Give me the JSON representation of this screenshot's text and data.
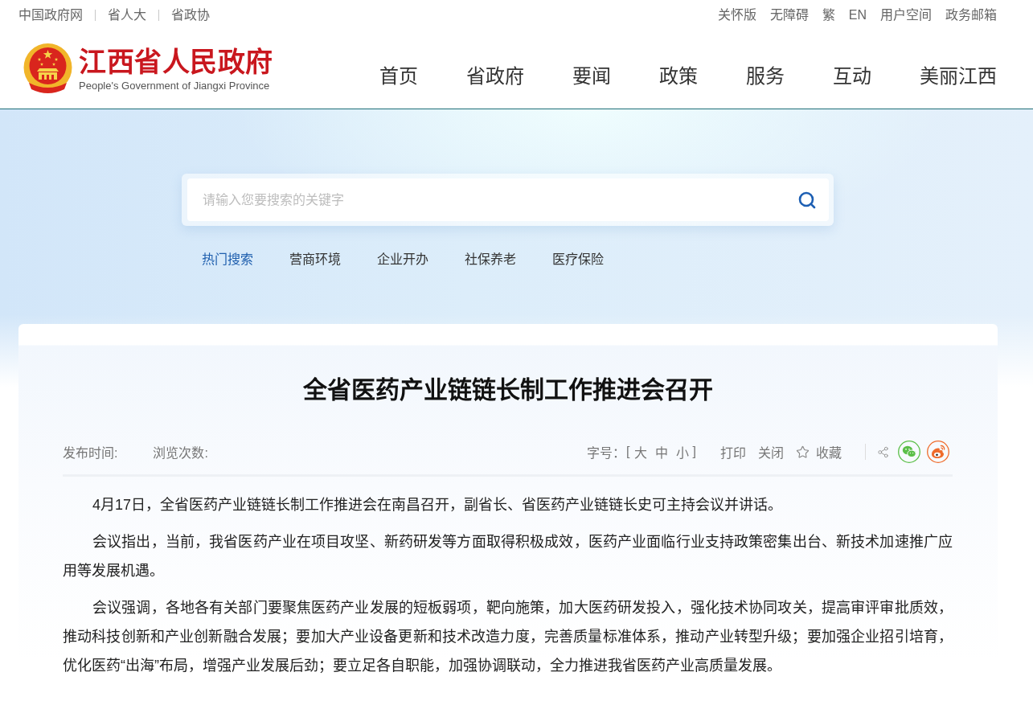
{
  "top_bar": {
    "left_links": [
      "中国政府网",
      "省人大",
      "省政协"
    ],
    "right_links": [
      "关怀版",
      "无障碍",
      "繁",
      "EN",
      "用户空间",
      "政务邮箱"
    ]
  },
  "header": {
    "site_title": "江西省人民政府",
    "site_subtitle": "People's Government of Jiangxi Province",
    "nav": [
      "首页",
      "省政府",
      "要闻",
      "政策",
      "服务",
      "互动",
      "美丽江西"
    ]
  },
  "search": {
    "placeholder": "请输入您要搜索的关键字"
  },
  "hot_search": {
    "label": "热门搜索",
    "items": [
      "营商环境",
      "企业开办",
      "社保养老",
      "医疗保险"
    ]
  },
  "article": {
    "title": "全省医药产业链链长制工作推进会召开",
    "meta": [
      "发布时间:",
      "浏览次数:"
    ],
    "tools": {
      "font_size_label": "字号：",
      "bracket_open": "[",
      "font_sizes": [
        "大",
        "中",
        "小"
      ],
      "bracket_close": "]",
      "actions": [
        "打印",
        "关闭"
      ],
      "favorite": "收藏"
    },
    "paragraphs": [
      "4月17日，全省医药产业链链长制工作推进会在南昌召开，副省长、省医药产业链链长史可主持会议并讲话。",
      "会议指出，当前，我省医药产业在项目攻坚、新药研发等方面取得积极成效，医药产业面临行业支持政策密集出台、新技术加速推广应用等发展机遇。",
      "会议强调，各地各有关部门要聚焦医药产业发展的短板弱项，靶向施策，加大医药研发投入，强化技术协同攻关，提高审评审批质效，推动科技创新和产业创新融合发展；要加大产业设备更新和技术改造力度，完善质量标准体系，推动产业转型升级；要加强企业招引培育，优化医药“出海”布局，增强产业发展后劲；要立足各自职能，加强协调联动，全力推进我省医药产业高质量发展。"
    ]
  }
}
